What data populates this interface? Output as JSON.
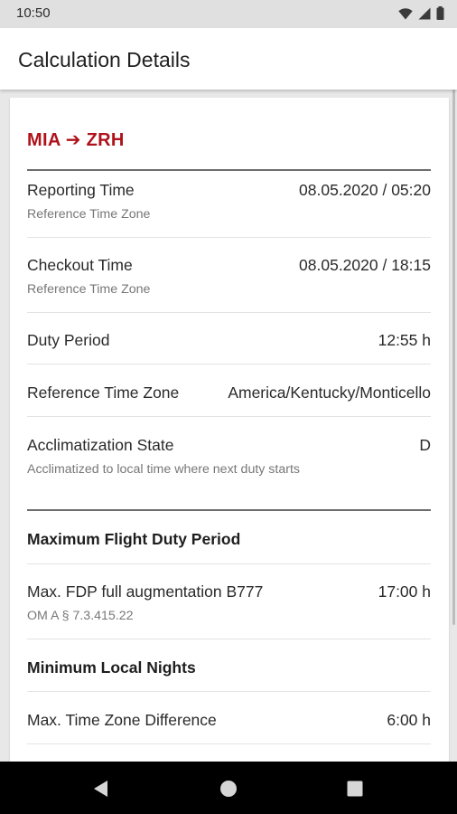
{
  "status_bar": {
    "time": "10:50",
    "icons": [
      "wifi-icon",
      "signal-icon",
      "battery-icon"
    ]
  },
  "app_bar": {
    "title": "Calculation Details"
  },
  "card": {
    "route": "MIA ➔ ZRH",
    "rows": [
      {
        "label": "Reporting Time",
        "value": "08.05.2020 / 05:20",
        "sub": "Reference Time Zone"
      },
      {
        "label": "Checkout Time",
        "value": "08.05.2020 / 18:15",
        "sub": "Reference Time Zone"
      },
      {
        "label": "Duty Period",
        "value": "12:55 h"
      },
      {
        "label": "Reference Time Zone",
        "value": "America/Kentucky/Monticello"
      },
      {
        "label": "Acclimatization State",
        "value": "D",
        "sub": "Acclimatized to local time where next duty starts"
      }
    ],
    "sections": [
      {
        "header": "Maximum Flight Duty Period",
        "rows": [
          {
            "label": "Max. FDP full augmentation B777",
            "value": "17:00 h",
            "sub": "OM A § 7.3.415.22"
          }
        ]
      },
      {
        "header": "Minimum Local Nights",
        "rows": [
          {
            "label": "Max. Time Zone Difference",
            "value": "6:00 h"
          }
        ]
      }
    ]
  },
  "colors": {
    "accent": "#b0121b",
    "status_bar": "#e0e0e0",
    "nav_bar": "#000000",
    "background": "#e8e8e8"
  },
  "nav_bar": {
    "buttons": [
      "back-icon",
      "home-icon",
      "recents-icon"
    ]
  }
}
